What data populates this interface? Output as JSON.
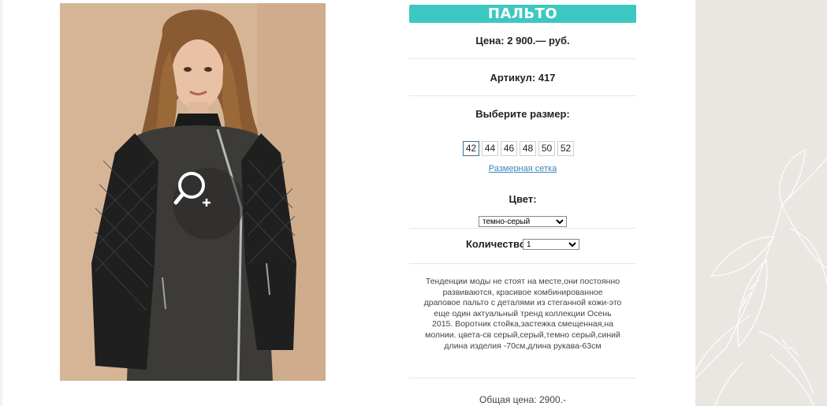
{
  "product": {
    "title": "ПАЛЬТО",
    "price_label": "Цена: 2 900.— руб.",
    "article_label": "Артикул: 417",
    "size_prompt": "Выберите размер:",
    "sizes": [
      "42",
      "44",
      "46",
      "48",
      "50",
      "52"
    ],
    "selected_size": "42",
    "size_chart_link": "Размерная сетка",
    "color_label": "Цвет:",
    "color_value": "темно-серый",
    "quantity_label": "Количество:",
    "quantity_value": "1",
    "description": "Тенденции моды не стоят на месте,они постоянно развиваются, красивое комбинированное драповое пальто с деталями из стеганной кожи-это еще один актуальный тренд коллекции Осень 2015. Воротник стойка,застежка смещенная,на молнии. цвета-св серый,серый,темно серый,синий длина изделия -70см,длина рукава-63см",
    "total_label": "Общая цена: 2900.-"
  },
  "icons": {
    "zoom": "zoom-in-icon"
  },
  "colors": {
    "title_bar": "#3cc8c0",
    "link": "#3a86b6",
    "side_decor": "#eae7e2"
  }
}
